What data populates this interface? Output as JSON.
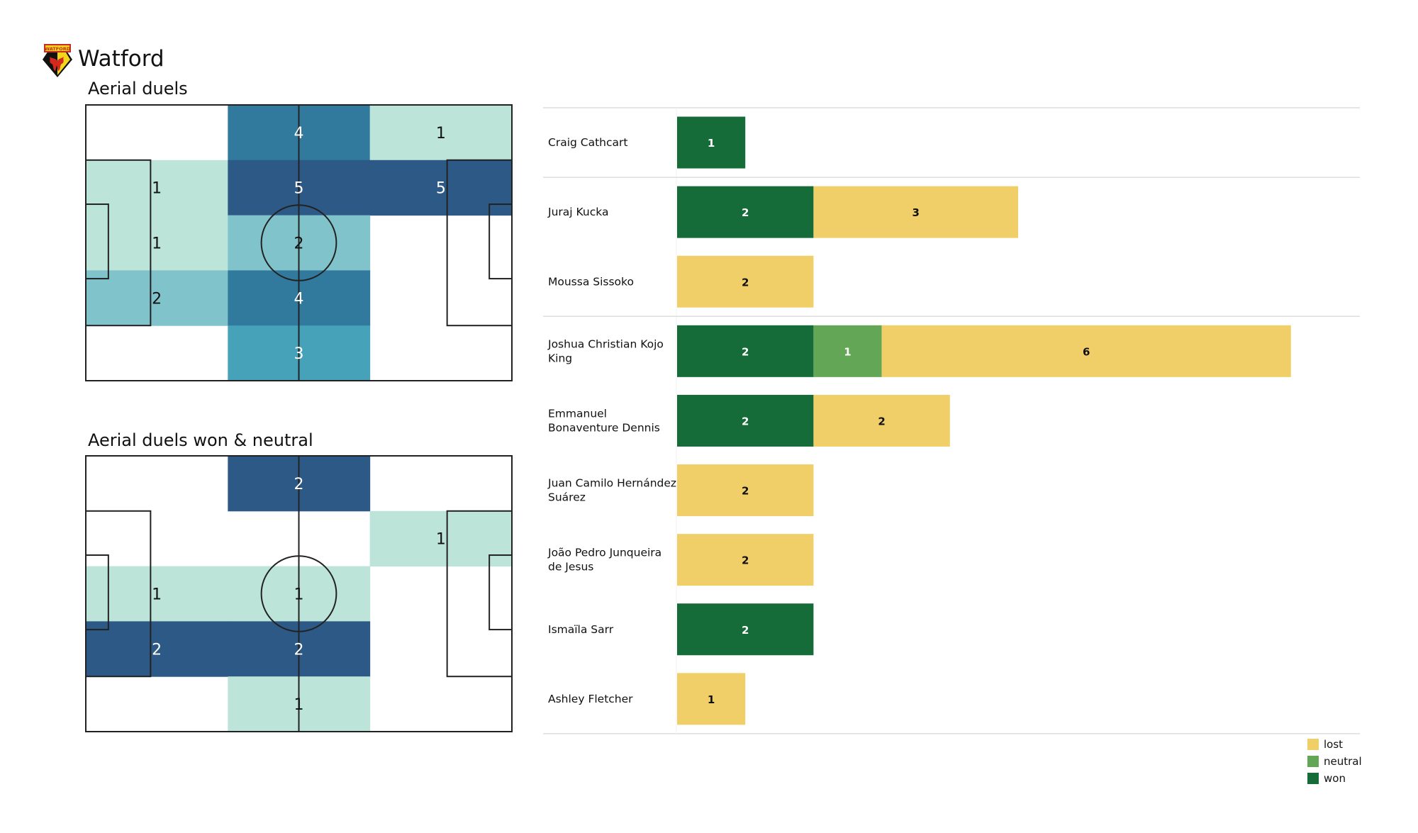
{
  "header": {
    "team_name": "Watford",
    "logo_icon": "watford-crest-icon",
    "logo_text": "WATFORD"
  },
  "colors": {
    "heat_scale": [
      "#ffffff",
      "#bce4d8",
      "#81c3cb",
      "#45a2b9",
      "#32799e",
      "#2c5985"
    ],
    "won": "#166c38",
    "neutral": "#62a656",
    "lost": "#f0cf68",
    "pitch_line": "#222222",
    "grid_line": "#dddddd"
  },
  "chart_data": [
    {
      "type": "heatmap",
      "title": "Aerial duels",
      "grid": {
        "columns": 3,
        "rows": 5
      },
      "max": 5,
      "values": [
        [
          null,
          4,
          1
        ],
        [
          1,
          5,
          5
        ],
        [
          1,
          2,
          null
        ],
        [
          2,
          4,
          null
        ],
        [
          null,
          3,
          null
        ]
      ]
    },
    {
      "type": "heatmap",
      "title": "Aerial duels won & neutral",
      "grid": {
        "columns": 3,
        "rows": 5
      },
      "max": 2,
      "values": [
        [
          null,
          2,
          null
        ],
        [
          null,
          null,
          1
        ],
        [
          1,
          1,
          null
        ],
        [
          2,
          2,
          null
        ],
        [
          null,
          1,
          null
        ]
      ]
    },
    {
      "type": "bar",
      "orientation": "horizontal-stacked",
      "series_order": [
        "won",
        "neutral",
        "lost"
      ],
      "categories": [
        "Craig Cathcart",
        "Juraj Kucka",
        "Moussa Sissoko",
        "Joshua Christian Kojo King",
        "Emmanuel Bonaventure Dennis",
        "Juan Camilo Hernández Suárez",
        "João Pedro Junqueira de Jesus",
        "Ismaïla Sarr",
        "Ashley Fletcher"
      ],
      "display_names": [
        [
          "Craig Cathcart"
        ],
        [
          "Juraj Kucka"
        ],
        [
          "Moussa Sissoko"
        ],
        [
          "Joshua Christian Kojo",
          "King"
        ],
        [
          "Emmanuel",
          "Bonaventure Dennis"
        ],
        [
          "Juan Camilo Hernández",
          "Suárez"
        ],
        [
          "João Pedro Junqueira",
          "de Jesus"
        ],
        [
          "Ismaïla Sarr"
        ],
        [
          "Ashley Fletcher"
        ]
      ],
      "series": [
        {
          "name": "won",
          "values": [
            1,
            2,
            0,
            2,
            2,
            0,
            0,
            2,
            0
          ]
        },
        {
          "name": "neutral",
          "values": [
            0,
            0,
            0,
            1,
            0,
            0,
            0,
            0,
            0
          ]
        },
        {
          "name": "lost",
          "values": [
            0,
            3,
            2,
            6,
            2,
            2,
            2,
            0,
            1
          ]
        }
      ],
      "group_separators_after": [
        0,
        2
      ],
      "legend": {
        "placement": "bottom-right",
        "entries": [
          "lost",
          "neutral",
          "won"
        ]
      }
    }
  ]
}
